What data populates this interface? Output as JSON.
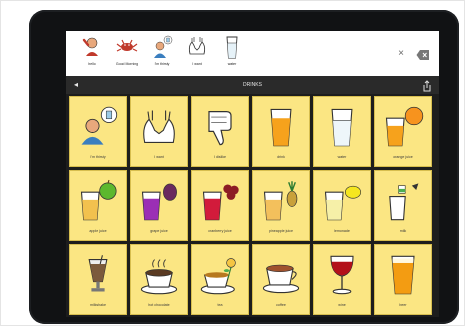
{
  "sentence_bar": {
    "words": [
      {
        "label": "hello",
        "icon": "hello-icon"
      },
      {
        "label": "Good Morning",
        "icon": "good-morning-icon"
      },
      {
        "label": "I'm thirsty",
        "icon": "thirsty-icon"
      },
      {
        "label": "I want",
        "icon": "i-want-icon"
      },
      {
        "label": "water",
        "icon": "water-icon"
      }
    ],
    "clear_symbol": "×",
    "backspace_icon": "backspace-icon"
  },
  "folder_header": {
    "back_symbol": "◂",
    "title": "DRINKS",
    "share_icon": "share-icon"
  },
  "grid": [
    {
      "label": "I'm thirsty",
      "icon": "thirsty-icon"
    },
    {
      "label": "I want",
      "icon": "hands-icon"
    },
    {
      "label": "I dislike",
      "icon": "thumbs-down-icon"
    },
    {
      "label": "drink",
      "icon": "drink-icon"
    },
    {
      "label": "water",
      "icon": "water-glass-icon"
    },
    {
      "label": "orange juice",
      "icon": "orange-juice-icon"
    },
    {
      "label": "apple juice",
      "icon": "apple-juice-icon"
    },
    {
      "label": "grape juice",
      "icon": "grape-juice-icon"
    },
    {
      "label": "cranberry juice",
      "icon": "cranberry-juice-icon"
    },
    {
      "label": "pineapple juice",
      "icon": "pineapple-juice-icon"
    },
    {
      "label": "lemonade",
      "icon": "lemonade-icon"
    },
    {
      "label": "milk",
      "icon": "milk-icon"
    },
    {
      "label": "milkshake",
      "icon": "milkshake-icon"
    },
    {
      "label": "hot chocolate",
      "icon": "hot-chocolate-icon"
    },
    {
      "label": "tea",
      "icon": "tea-icon"
    },
    {
      "label": "coffee",
      "icon": "coffee-icon"
    },
    {
      "label": "wine",
      "icon": "wine-icon"
    },
    {
      "label": "beer",
      "icon": "beer-icon"
    }
  ],
  "colors": {
    "cell_background": "#fbe683",
    "cell_border": "#d7be4f",
    "header_background": "#2a2a2a",
    "tablet_bezel": "#111214"
  }
}
